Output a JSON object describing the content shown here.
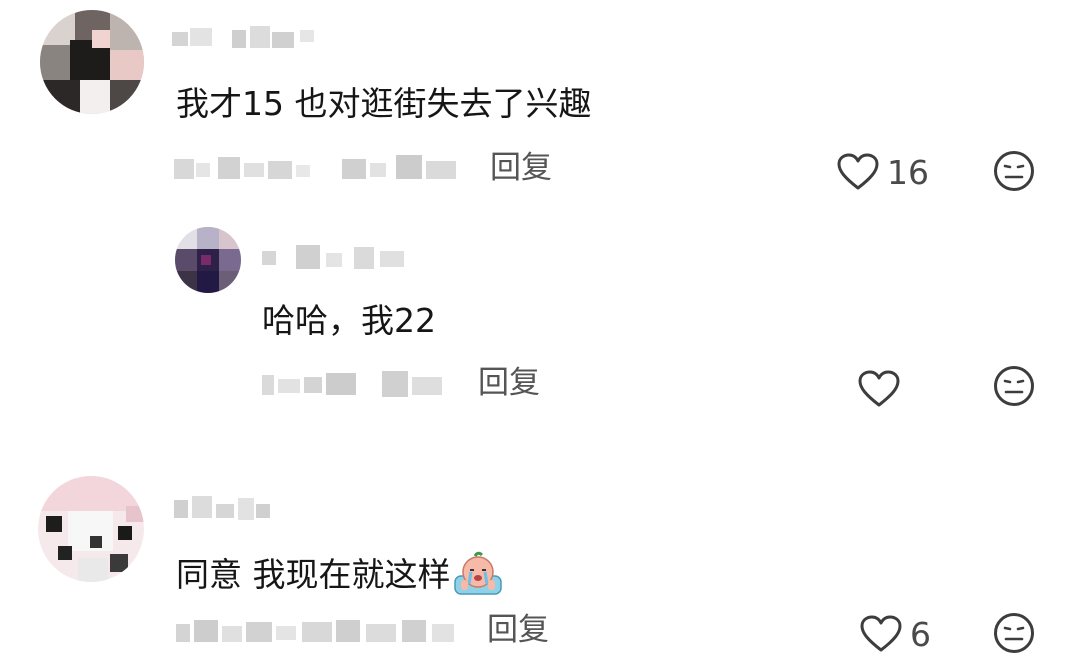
{
  "comments": [
    {
      "text": "我才15 也对逛街失去了兴趣",
      "reply_label": "回复",
      "likes": "16",
      "avatar_icon": "blurred-avatar",
      "like_icon": "heart-outline-icon",
      "dislike_icon": "meh-face-icon"
    },
    {
      "text": "哈哈，我22",
      "reply_label": "回复",
      "likes": "",
      "avatar_icon": "blurred-avatar",
      "like_icon": "heart-outline-icon",
      "dislike_icon": "meh-face-icon"
    },
    {
      "text": "同意 我现在就这样",
      "emoji": "crying-emoji",
      "reply_label": "回复",
      "likes": "6",
      "avatar_icon": "blurred-avatar",
      "like_icon": "heart-outline-icon",
      "dislike_icon": "meh-face-icon"
    }
  ],
  "colors": {
    "text": "#161616",
    "secondary": "#555555",
    "icon": "#3d3d3d",
    "background": "#ffffff"
  }
}
